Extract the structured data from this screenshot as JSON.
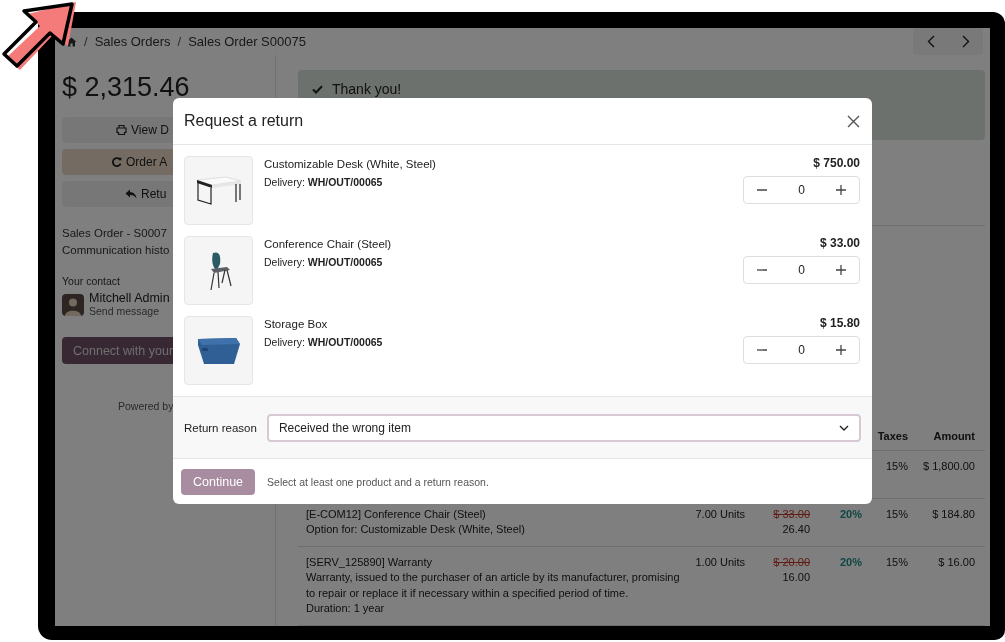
{
  "breadcrumb": [
    {
      "kind": "separator",
      "text": "/"
    },
    {
      "kind": "link",
      "text": "Sales Orders"
    },
    {
      "kind": "separator",
      "text": "/"
    },
    {
      "kind": "current",
      "text": "Sales Order S00075"
    }
  ],
  "sidebar": {
    "total": "$ 2,315.46",
    "buttons": [
      {
        "kind": "print",
        "label": "View D",
        "highlighted": false
      },
      {
        "kind": "reorder",
        "label": "Order A",
        "highlighted": true
      },
      {
        "kind": "return",
        "label": "Retu",
        "highlighted": false
      }
    ],
    "order_title": "Sales Order - S0007",
    "communication": "Communication histo",
    "contact_label": "Your contact",
    "contact_name": "Mitchell Admin",
    "contact_action": "Send message",
    "connect_button": "Connect with your",
    "powered_by": "Powered by"
  },
  "alert": {
    "text": "Thank you!"
  },
  "table": {
    "columns": [
      {
        "label": "Taxes"
      },
      {
        "label": "Amount"
      }
    ],
    "rows": [
      {
        "taxes": "15%",
        "amount": "$ 1,800.00"
      },
      {
        "product": "[E-COM12] Conference Chair (Steel)",
        "notes": [
          "Option for: Customizable Desk (White, Steel)"
        ],
        "quantity": "7.00 Units",
        "list_price": "$ 33.00",
        "price": "26.40",
        "discount": "20%",
        "taxes": "15%",
        "amount": "$ 184.80"
      },
      {
        "product": "[SERV_125890] Warranty",
        "notes": [
          "Warranty, issued to the purchaser of an article by its manufacturer, promising to repair or replace it if necessary within a specified period of time.",
          "Duration: 1 year"
        ],
        "quantity": "1.00 Units",
        "list_price": "$ 20.00",
        "price": "16.00",
        "discount": "20%",
        "taxes": "15%",
        "amount": "$ 16.00"
      }
    ]
  },
  "modal": {
    "title": "Request a return",
    "products": [
      {
        "kind": "desk",
        "name": "Customizable Desk (White, Steel)",
        "delivery": "Delivery: **WH/OUT/00065**",
        "price": "$ 750.00",
        "quantity": "0"
      },
      {
        "kind": "chair",
        "name": "Conference Chair (Steel)",
        "delivery": "Delivery: **WH/OUT/00065**",
        "price": "$ 33.00",
        "quantity": "0"
      },
      {
        "kind": "box",
        "name": "Storage Box",
        "delivery": "Delivery: **WH/OUT/00065**",
        "price": "$ 15.80",
        "quantity": "0"
      }
    ],
    "reason_label": "Return reason",
    "reason": {
      "value": "Received the wrong item"
    },
    "continue_button": {
      "label": "Continue",
      "disabled": true
    },
    "hint": "Select at least one product and a return reason."
  }
}
